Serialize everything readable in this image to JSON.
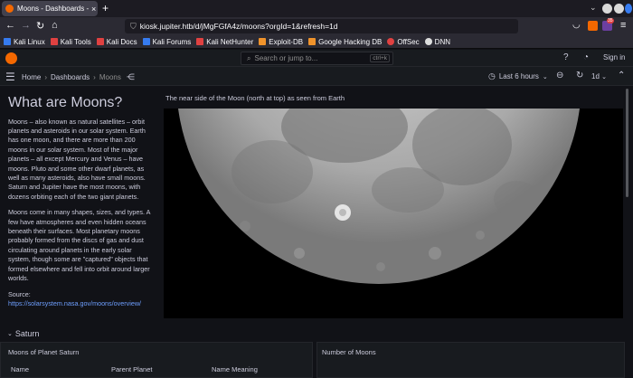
{
  "browser": {
    "tab_title": "Moons - Dashboards - Gr",
    "new_tab": "+",
    "url": "kiosk.jupiter.htb/d/jMgFGfA4z/moons?orgId=1&refresh=1d",
    "extension_badge": "35",
    "bookmarks": [
      {
        "label": "Kali Linux",
        "color": "#367bf0"
      },
      {
        "label": "Kali Tools",
        "color": "#e04141"
      },
      {
        "label": "Kali Docs",
        "color": "#e04141"
      },
      {
        "label": "Kali Forums",
        "color": "#367bf0"
      },
      {
        "label": "Kali NetHunter",
        "color": "#e04141"
      },
      {
        "label": "Exploit-DB",
        "color": "#f0932b"
      },
      {
        "label": "Google Hacking DB",
        "color": "#f0932b"
      },
      {
        "label": "OffSec",
        "color": "#e04141"
      },
      {
        "label": "DNN",
        "color": "#dddddd"
      }
    ]
  },
  "grafana": {
    "search_placeholder": "Search or jump to...",
    "search_shortcut": "ctrl+k",
    "sign_in": "Sign in",
    "breadcrumbs": {
      "home": "Home",
      "dashboards": "Dashboards",
      "current": "Moons"
    },
    "time_range": "Last 6 hours",
    "refresh_interval": "1d"
  },
  "text_panel": {
    "title": "What are Moons?",
    "paragraph1": "Moons – also known as natural satellites – orbit planets and asteroids in our solar system. Earth has one moon, and there are more than 200 moons in our solar system. Most of the major planets – all except Mercury and Venus – have moons. Pluto and some other dwarf planets, as well as many asteroids, also have small moons. Saturn and Jupiter have the most moons, with dozens orbiting each of the two giant planets.",
    "paragraph2": "Moons come in many shapes, sizes, and types. A few have atmospheres and even hidden oceans beneath their surfaces. Most planetary moons probably formed from the discs of gas and dust circulating around planets in the early solar system, though some are \"captured\" objects that formed elsewhere and fell into orbit around larger worlds.",
    "source_label": "Source: ",
    "source_link": "https://solarsystem.nasa.gov/moons/overview/"
  },
  "image_panel": {
    "title": "The near side of the Moon (north at top) as seen from Earth"
  },
  "row": {
    "title": "Saturn"
  },
  "table_panel": {
    "title": "Moons of Planet Saturn",
    "columns": [
      "Name",
      "Parent Planet",
      "Name Meaning"
    ]
  },
  "stat_panel": {
    "title": "Number of Moons"
  },
  "colors": {
    "grafana_orange": "#f46800",
    "link_blue": "#6e9fff",
    "bg": "#111217",
    "panel_bg": "#181b1f"
  }
}
